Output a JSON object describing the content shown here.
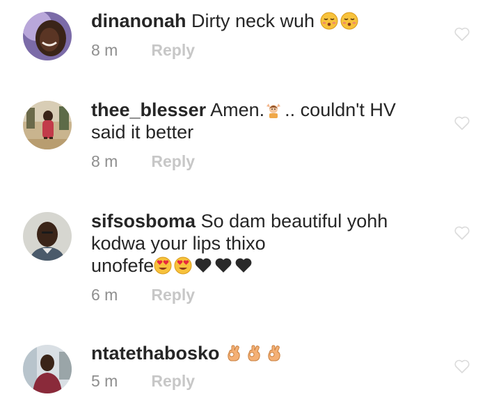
{
  "comments": [
    {
      "username": "dinanonah",
      "text": "Dirty neck wuh",
      "emojis": [
        "kissing-face-closed-eyes-emoji",
        "kissing-face-closed-eyes-emoji"
      ],
      "time": "8 m",
      "reply_label": "Reply"
    },
    {
      "username": "thee_blesser",
      "text_before_emoji": "Amen.",
      "emoji": "person-raising-hands-emoji",
      "text_after_emoji": ".. couldn't HV",
      "text_line2": "said it better",
      "time": "8 m",
      "reply_label": "Reply"
    },
    {
      "username": "sifsosboma",
      "text_line1": "So dam beautiful yohh",
      "text_line2": "kodwa your lips thixo",
      "text_line3": "unofefe",
      "emojis": [
        "heart-eyes-emoji",
        "heart-eyes-emoji",
        "black-heart-emoji",
        "black-heart-emoji",
        "black-heart-emoji"
      ],
      "time": "6 m",
      "reply_label": "Reply"
    },
    {
      "username": "ntatethabosko",
      "emojis": [
        "ok-hand-emoji",
        "ok-hand-emoji",
        "ok-hand-emoji"
      ],
      "time": "5 m",
      "reply_label": "Reply"
    }
  ],
  "colors": {
    "text": "#262626",
    "meta": "#8e8e8e",
    "reply": "#c7c7c7",
    "heart_outline": "#dbdbdb"
  }
}
